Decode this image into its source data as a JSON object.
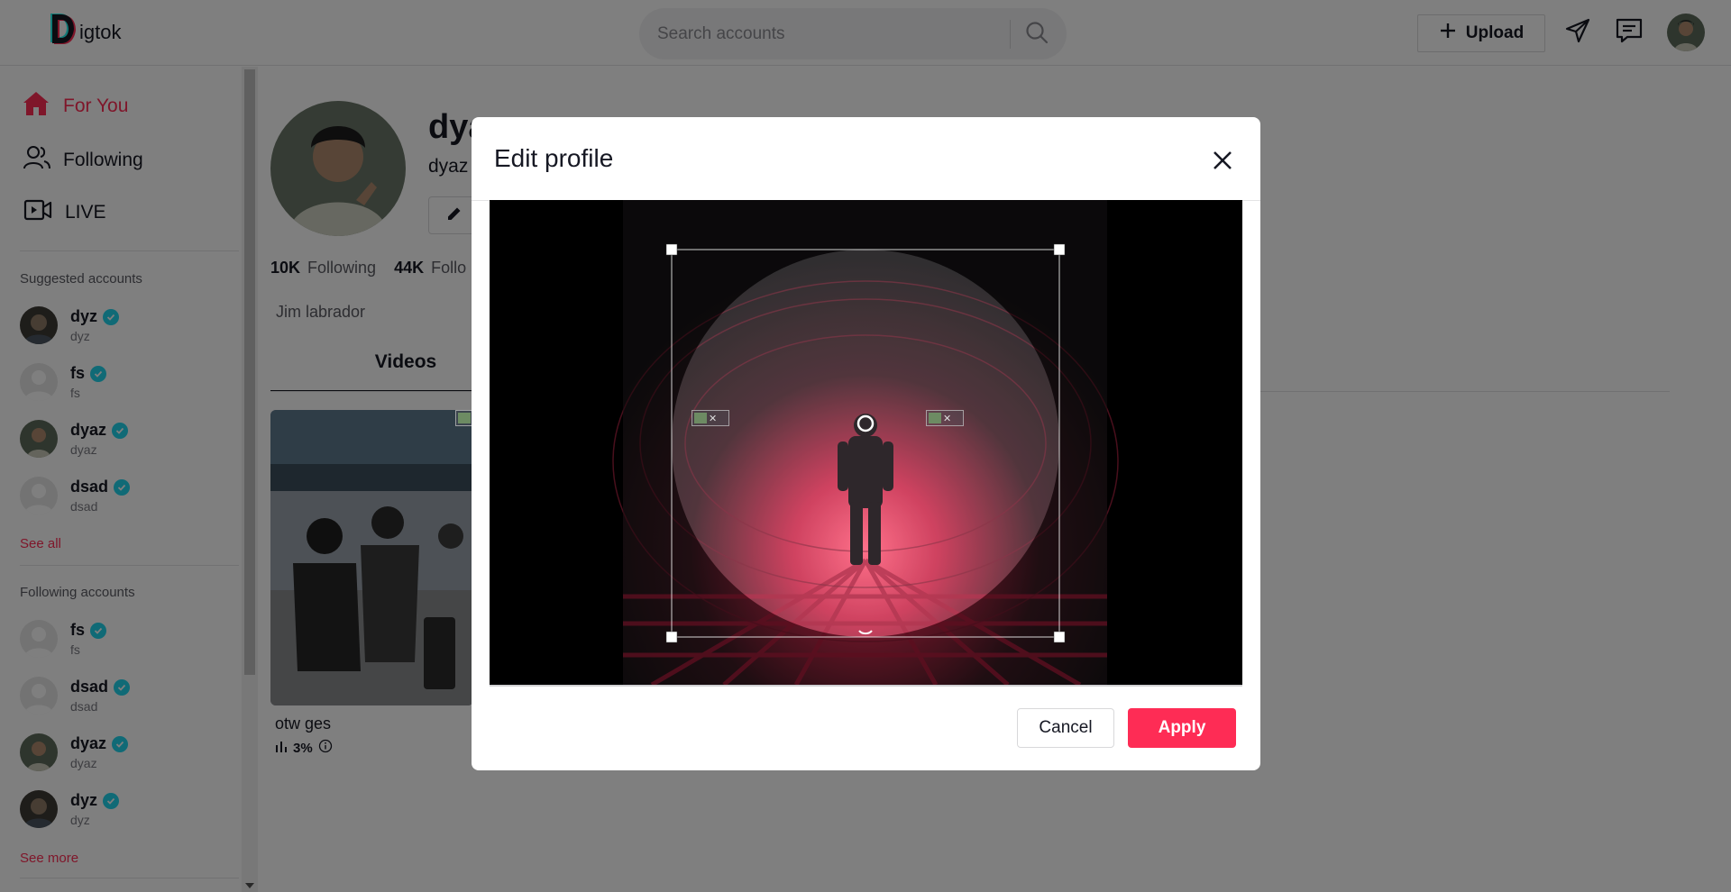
{
  "header": {
    "logo_text": "igtok",
    "search_placeholder": "Search accounts",
    "upload_label": "Upload"
  },
  "sidebar": {
    "nav": [
      {
        "label": "For You",
        "icon": "home-icon",
        "active": true
      },
      {
        "label": "Following",
        "icon": "users-icon"
      },
      {
        "label": "LIVE",
        "icon": "live-icon"
      }
    ],
    "suggested_title": "Suggested accounts",
    "suggested": [
      {
        "name": "dyz",
        "handle": "dyz"
      },
      {
        "name": "fs",
        "handle": "fs"
      },
      {
        "name": "dyaz",
        "handle": "dyaz"
      },
      {
        "name": "dsad",
        "handle": "dsad"
      }
    ],
    "see_all": "See all",
    "following_title": "Following accounts",
    "following": [
      {
        "name": "fs",
        "handle": "fs"
      },
      {
        "name": "dsad",
        "handle": "dsad"
      },
      {
        "name": "dyaz",
        "handle": "dyaz"
      },
      {
        "name": "dyz",
        "handle": "dyz"
      }
    ],
    "see_more": "See more"
  },
  "profile": {
    "title_partial": "dya",
    "subtitle_partial": "dyaz",
    "following_count": "10K",
    "following_label": "Following",
    "followers_count": "44K",
    "followers_label_partial": "Follo",
    "bio": "Jim labrador",
    "tab_videos": "Videos",
    "video": {
      "title": "otw ges",
      "stat": "3%"
    }
  },
  "modal": {
    "title": "Edit profile",
    "cancel_label": "Cancel",
    "apply_label": "Apply"
  },
  "colors": {
    "accent": "#fe2c55",
    "verified": "#20d5ec"
  }
}
